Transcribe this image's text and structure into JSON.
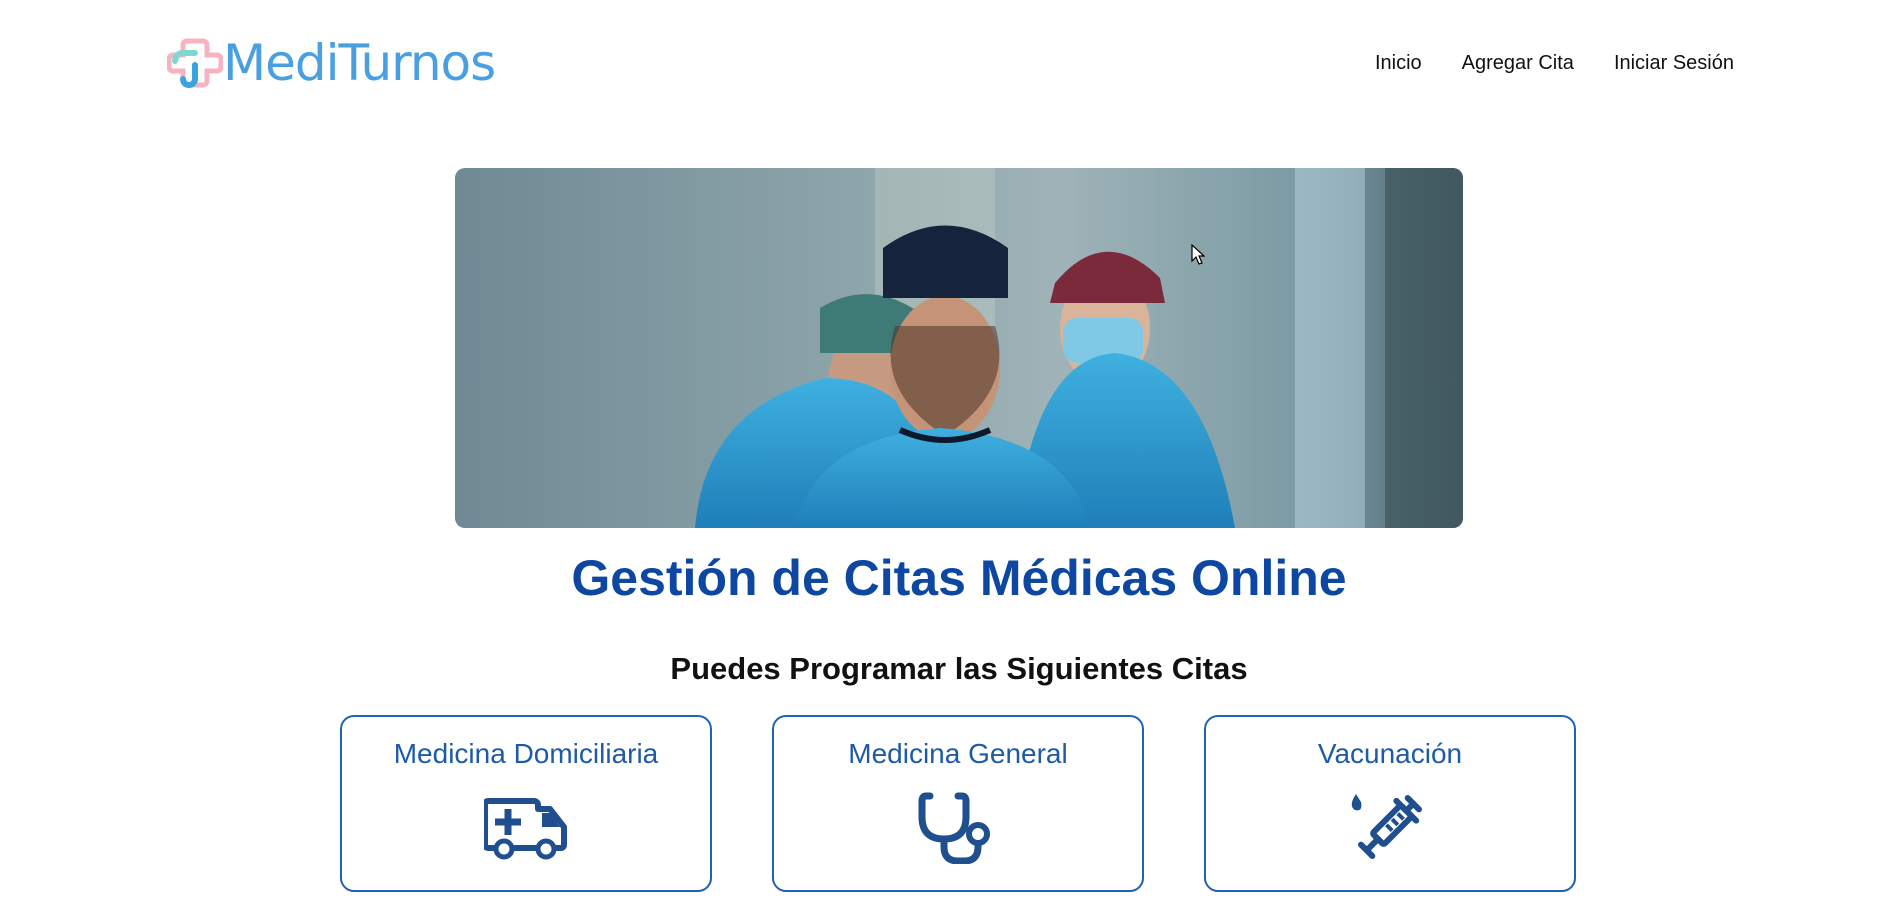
{
  "brand": {
    "name": "MediTurnos"
  },
  "nav": {
    "items": [
      {
        "label": "Inicio"
      },
      {
        "label": "Agregar Cita"
      },
      {
        "label": "Iniciar Sesión"
      }
    ]
  },
  "hero": {
    "image_icon": "surgeons-photo"
  },
  "main": {
    "title": "Gestión de Citas Médicas Online",
    "subtitle": "Puedes Programar las Siguientes Citas",
    "cards": [
      {
        "label": "Medicina Domiciliaria",
        "icon": "ambulance-icon"
      },
      {
        "label": "Medicina General",
        "icon": "stethoscope-icon"
      },
      {
        "label": "Vacunación",
        "icon": "syringe-icon"
      }
    ]
  },
  "colors": {
    "brand": "#4a9fe0",
    "title": "#0d47a1",
    "card_border": "#1e63b8",
    "card_text": "#1e5aa8",
    "icon": "#1f4f8f"
  }
}
